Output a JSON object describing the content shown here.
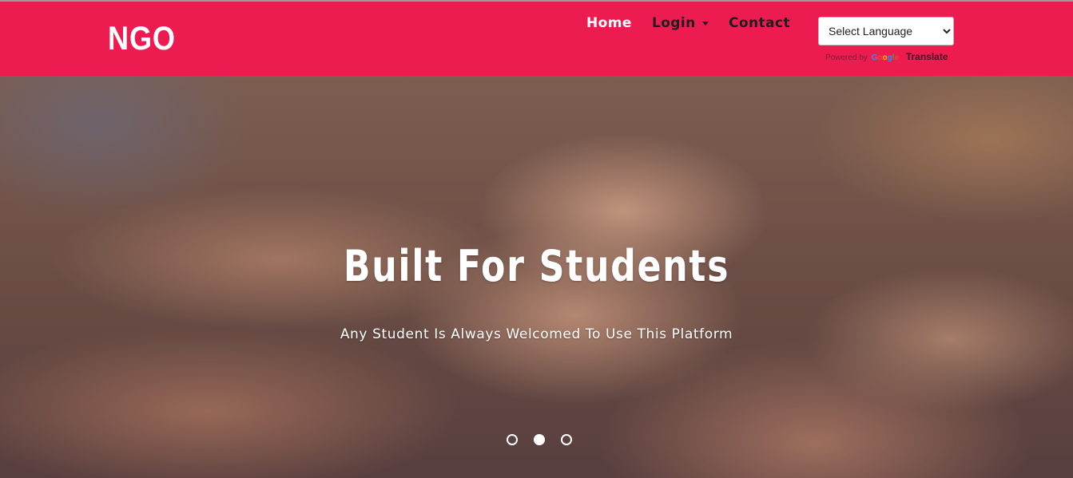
{
  "navbar": {
    "brand": "NGO",
    "background": "#ed1c50",
    "links": [
      {
        "label": "Home"
      },
      {
        "label": "Login"
      },
      {
        "label": "Contact"
      }
    ],
    "language_select": {
      "selected": "Select Language",
      "powered_by": "Powered by",
      "google_letters": [
        "G",
        "o",
        "o",
        "g",
        "l",
        "e"
      ],
      "translate_label": "Translate"
    }
  },
  "hero": {
    "title": "Built For Students",
    "subtitle": "Any Student Is Always Welcomed To Use This Platform",
    "slides_count": 3,
    "active_slide": 2
  }
}
